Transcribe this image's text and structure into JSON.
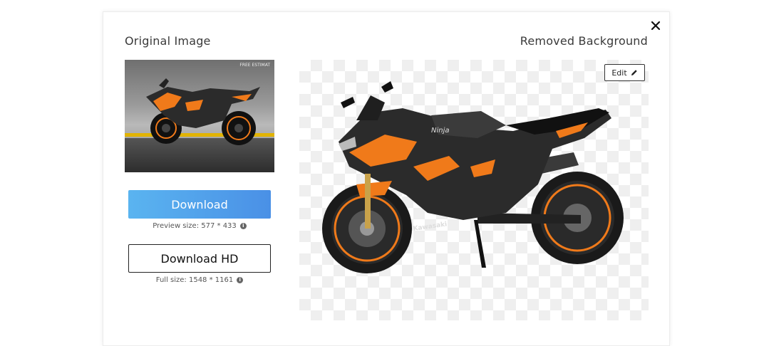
{
  "modal": {
    "left_title": "Original Image",
    "right_title": "Removed Background",
    "close_icon": "close-icon"
  },
  "original": {
    "thumb_sign": "FREE ESTIMAT",
    "download_label": "Download",
    "preview_size": "Preview size: 577 * 433",
    "download_hd_label": "Download HD",
    "full_size": "Full size: 1548 * 1161",
    "info_icon": "info-icon"
  },
  "result": {
    "edit_label": "Edit",
    "edit_icon": "pencil-icon",
    "brand_text": "Kawasaki",
    "model_text": "Ninja"
  },
  "colors": {
    "primary_start": "#5ab4f0",
    "primary_end": "#4a90e6",
    "bike_orange": "#f07a1a",
    "bike_dark": "#2b2b2b"
  }
}
